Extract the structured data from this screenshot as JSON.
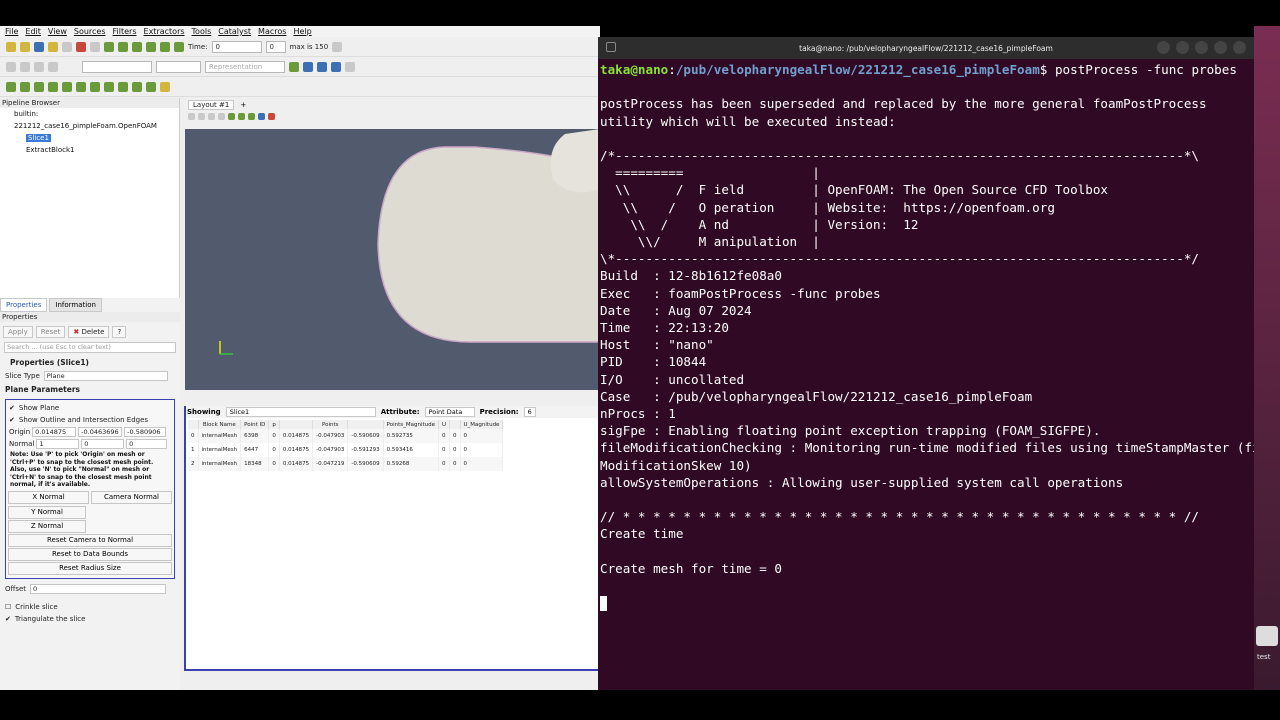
{
  "menu": [
    "File",
    "Edit",
    "View",
    "Sources",
    "Filters",
    "Extractors",
    "Tools",
    "Catalyst",
    "Macros",
    "Help"
  ],
  "toolbar": {
    "time_label": "Time:",
    "time_value": "0",
    "step_value": "0",
    "max_label": "max is 150",
    "representation": "Representation"
  },
  "pipeline": {
    "title": "Pipeline Browser",
    "builtin": "builtin:",
    "file": "221212_case16_pimpleFoam.OpenFOAM",
    "slice": "Slice1",
    "extract": "ExtractBlock1"
  },
  "props": {
    "tab_properties": "Properties",
    "tab_information": "Information",
    "header": "Properties",
    "apply": "Apply",
    "reset": "Reset",
    "delete": "Delete",
    "help": "?",
    "search_placeholder": "Search ... (use Esc to clear text)",
    "section_title": "Properties (Slice1)",
    "slice_type_label": "Slice Type",
    "slice_type": "Plane",
    "plane_params": "Plane Parameters",
    "show_plane": "Show Plane",
    "show_outline": "Show Outline and Intersection Edges",
    "origin_label": "Origin",
    "origin": [
      "0.014875",
      "-0.0463696",
      "-0.580906"
    ],
    "normal_label": "Normal",
    "normal": [
      "1",
      "0",
      "0"
    ],
    "note": "Note: Use 'P' to pick 'Origin' on mesh or 'Ctrl+P' to snap to the closest mesh point. Also, use 'N' to pick \"Normal\" on mesh or 'Ctrl+N' to snap to the closest mesh point normal, if it's available.",
    "x_normal": "X Normal",
    "camera_normal": "Camera Normal",
    "y_normal": "Y Normal",
    "z_normal": "Z Normal",
    "reset_camera": "Reset Camera to Normal",
    "reset_bounds": "Reset to Data Bounds",
    "reset_radius": "Reset Radius Size",
    "offset_label": "Offset",
    "offset": "0",
    "crinkle": "Crinkle slice",
    "triangulate": "Triangulate the slice"
  },
  "layout": {
    "tab": "Layout #1",
    "plus": "+"
  },
  "spreadsheet": {
    "showing": "Showing",
    "source": "Slice1",
    "attribute_label": "Attribute:",
    "attribute": "Point Data",
    "precision_label": "Precision:",
    "precision": "6",
    "columns": [
      "",
      "Block Name",
      "Point ID",
      "p",
      "",
      "Points",
      "",
      "Points_Magnitude",
      "U",
      "",
      "U_Magnitude"
    ],
    "rows": [
      [
        "0",
        "internalMesh",
        "6398",
        "0",
        "0.014875",
        "-0.047903",
        "-0.590609",
        "0.592735",
        "0",
        "0",
        "0"
      ],
      [
        "1",
        "internalMesh",
        "6447",
        "0",
        "0.014875",
        "-0.047903",
        "-0.591293",
        "0.593416",
        "0",
        "0",
        "0"
      ],
      [
        "2",
        "internalMesh",
        "18348",
        "0",
        "0.014875",
        "-0.047219",
        "-0.590609",
        "0.59268",
        "0",
        "0",
        "0"
      ]
    ]
  },
  "terminal": {
    "title": "taka@nano: /pub/velopharyngealFlow/221212_case16_pimpleFoam",
    "user": "taka@nano",
    "path": "/pub/velopharyngealFlow/221212_case16_pimpleFoam",
    "command": "$ postProcess -func probes",
    "lines": [
      "",
      "postProcess has been superseded and replaced by the more general foamPostProcess",
      "utility which will be executed instead:",
      "",
      "/*---------------------------------------------------------------------------*\\",
      "  =========                 |",
      "  \\\\      /  F ield         | OpenFOAM: The Open Source CFD Toolbox",
      "   \\\\    /   O peration     | Website:  https://openfoam.org",
      "    \\\\  /    A nd           | Version:  12",
      "     \\\\/     M anipulation  |",
      "\\*---------------------------------------------------------------------------*/",
      "Build  : 12-8b1612fe08a0",
      "Exec   : foamPostProcess -func probes",
      "Date   : Aug 07 2024",
      "Time   : 22:13:20",
      "Host   : \"nano\"",
      "PID    : 10844",
      "I/O    : uncollated",
      "Case   : /pub/velopharyngealFlow/221212_case16_pimpleFoam",
      "nProcs : 1",
      "sigFpe : Enabling floating point exception trapping (FOAM_SIGFPE).",
      "fileModificationChecking : Monitoring run-time modified files using timeStampMaster (file",
      "ModificationSkew 10)",
      "allowSystemOperations : Allowing user-supplied system call operations",
      "",
      "// * * * * * * * * * * * * * * * * * * * * * * * * * * * * * * * * * * * * * //",
      "Create time",
      "",
      "Create mesh for time = 0",
      ""
    ]
  },
  "side_text": "test"
}
